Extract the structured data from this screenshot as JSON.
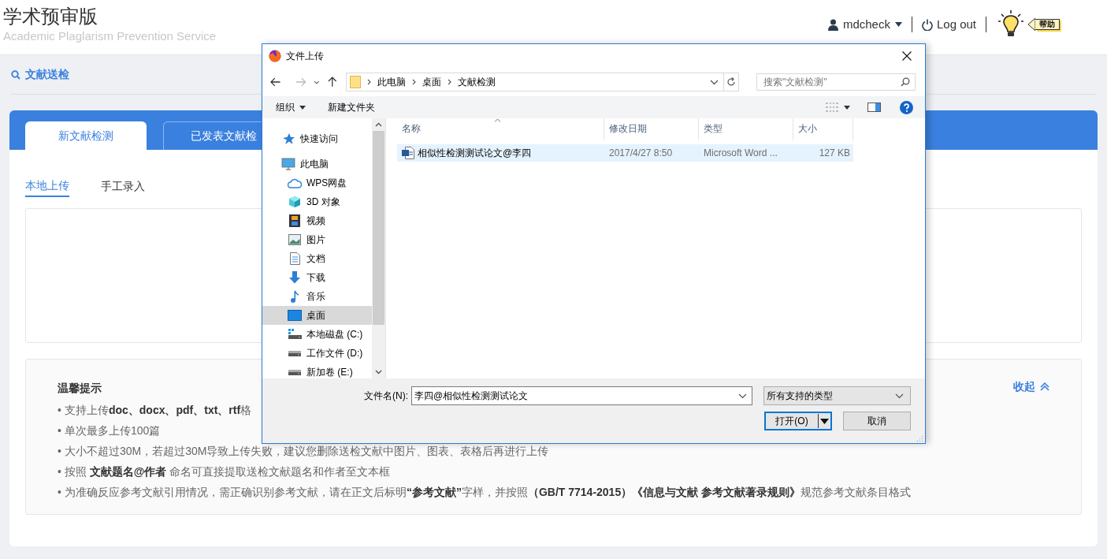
{
  "header": {
    "title": "学术预审版",
    "subtitle": "Academic Plaglarism Prevention Service",
    "user": "mdcheck",
    "logout": "Log out",
    "help": "帮助"
  },
  "breadcrumb": "文献送检",
  "tabs": [
    {
      "label": "新文献检测",
      "selected": true
    },
    {
      "label": "已发表文献检",
      "selected": false
    }
  ],
  "subtabs": [
    {
      "label": "本地上传",
      "selected": true
    },
    {
      "label": "手工录入",
      "selected": false
    }
  ],
  "tips": {
    "title": "温馨提示",
    "collapse": "收起",
    "items": [
      {
        "bullet": "•",
        "text": "支持上传**doc、docx、pdf、txt、rtf**格"
      },
      {
        "bullet": "•",
        "text": "单次最多上传100篇"
      },
      {
        "bullet": "•",
        "text": "大小不超过30M，若超过30M导致上传失败，建议您删除送检文献中图片、图表、表格后再进行上传"
      },
      {
        "bullet": "•",
        "text": "按照 **文献题名@作者** 命名可直接提取送检文献题名和作者至文本框"
      },
      {
        "bullet": "•",
        "text": "为准确反应参考文献引用情况，需正确识别参考文献，请在正文后标明**“参考文献”**字样，并按照**（GB/T 7714-2015）《信息与文献 参考文献著录规则》**规范参考文献条目格式"
      }
    ]
  },
  "dialog": {
    "title": "文件上传",
    "path": [
      "此电脑",
      "桌面",
      "文献检测"
    ],
    "search_placeholder": "搜索\"文献检测\"",
    "toolbar": {
      "organize": "组织",
      "new_folder": "新建文件夹"
    },
    "nav": [
      {
        "label": "快速访问",
        "kind": "star",
        "selected": false
      },
      {
        "label": "此电脑",
        "kind": "pc",
        "selected": false,
        "children": [
          {
            "label": "WPS网盘",
            "kind": "cloud",
            "selected": false
          },
          {
            "label": "3D 对象",
            "kind": "cube",
            "selected": false
          },
          {
            "label": "视频",
            "kind": "film",
            "selected": false
          },
          {
            "label": "图片",
            "kind": "image",
            "selected": false
          },
          {
            "label": "文档",
            "kind": "doc",
            "selected": false
          },
          {
            "label": "下载",
            "kind": "download",
            "selected": false
          },
          {
            "label": "音乐",
            "kind": "music",
            "selected": false
          },
          {
            "label": "桌面",
            "kind": "desktop",
            "selected": true
          },
          {
            "label": "本地磁盘 (C:)",
            "kind": "disk",
            "selected": false
          },
          {
            "label": "工作文件 (D:)",
            "kind": "drive",
            "selected": false
          },
          {
            "label": "新加卷 (E:)",
            "kind": "drive",
            "selected": false
          }
        ]
      }
    ],
    "columns": [
      "名称",
      "修改日期",
      "类型",
      "大小"
    ],
    "files": [
      {
        "name": "相似性检测测试论文@李四",
        "date": "2017/4/27 8:50",
        "type": "Microsoft Word ...",
        "size": "127 KB",
        "selected": true
      }
    ],
    "filename_label": "文件名(N):",
    "filename": "李四@相似性检测测试论文",
    "filetype": "所有支持的类型",
    "open": "打开(O)",
    "cancel": "取消"
  }
}
